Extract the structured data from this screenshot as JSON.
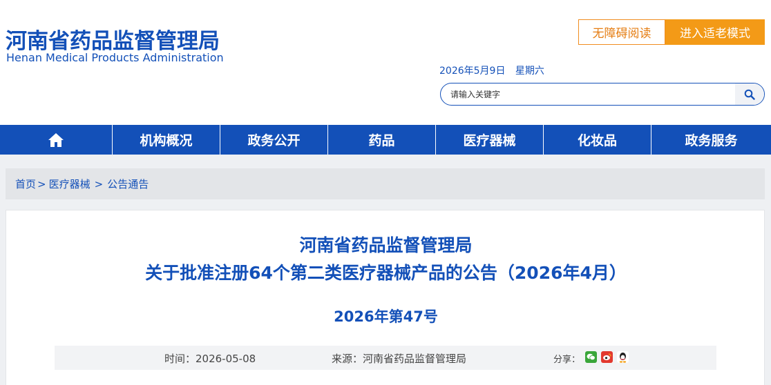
{
  "header": {
    "logo_cn": "河南省药品监督管理局",
    "logo_en": "Henan Medical Products Administration",
    "accessibility_label": "无障碍阅读",
    "elder_mode_label": "进入适老模式",
    "date": "2026年5月9日",
    "weekday": "星期六",
    "search_placeholder": "请输入关键字"
  },
  "nav": {
    "home_icon": "home-icon",
    "items": [
      "机构概况",
      "政务公开",
      "药品",
      "医疗器械",
      "化妆品",
      "政务服务"
    ]
  },
  "breadcrumb": {
    "items": [
      "首页",
      "医疗器械",
      "公告通告"
    ],
    "separators": [
      ">",
      ">"
    ]
  },
  "article": {
    "title_line1": "河南省药品监督管理局",
    "title_line2": "关于批准注册64个第二类医疗器械产品的公告（2026年4月）",
    "doc_number": "2026年第47号",
    "time": "时间：2026-05-08",
    "source": "来源：河南省药品监督管理局",
    "share_label": "分享：",
    "share_icons": [
      "wechat-icon",
      "weibo-icon",
      "qq-icon"
    ]
  },
  "colors": {
    "brand_blue": "#1350b8",
    "accent_orange": "#f39a17"
  }
}
